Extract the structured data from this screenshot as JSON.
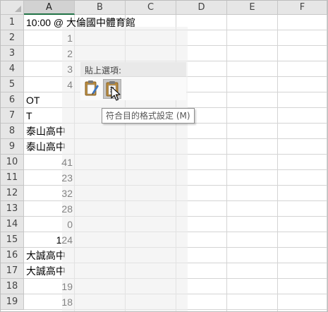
{
  "columns": [
    "A",
    "B",
    "C",
    "D",
    "E",
    "F"
  ],
  "selected_column": "A",
  "rows": [
    {
      "num": "1",
      "a": "10:00 @ 大倫國中體育館",
      "align": "left"
    },
    {
      "num": "2",
      "a": "1",
      "align": "right"
    },
    {
      "num": "3",
      "a": "2",
      "align": "right"
    },
    {
      "num": "4",
      "a": "3",
      "align": "right"
    },
    {
      "num": "5",
      "a": "4",
      "align": "right"
    },
    {
      "num": "6",
      "a": "OT",
      "align": "left"
    },
    {
      "num": "7",
      "a": "T",
      "align": "left"
    },
    {
      "num": "8",
      "a": "泰山高中",
      "align": "left"
    },
    {
      "num": "9",
      "a": "泰山高中",
      "align": "left"
    },
    {
      "num": "10",
      "a": "41",
      "align": "right"
    },
    {
      "num": "11",
      "a": "23",
      "align": "right"
    },
    {
      "num": "12",
      "a": "32",
      "align": "right"
    },
    {
      "num": "13",
      "a": "28",
      "align": "right"
    },
    {
      "num": "14",
      "a": "0",
      "align": "right"
    },
    {
      "num": "15",
      "a": "124",
      "align": "right"
    },
    {
      "num": "16",
      "a": "大誠高中",
      "align": "left"
    },
    {
      "num": "17",
      "a": "大誠高中",
      "align": "left"
    },
    {
      "num": "18",
      "a": "19",
      "align": "right"
    },
    {
      "num": "19",
      "a": "18",
      "align": "right"
    }
  ],
  "paste_options": {
    "label": "貼上選項:",
    "buttons": [
      {
        "icon": "keep-source-formatting-icon"
      },
      {
        "icon": "match-destination-formatting-icon"
      }
    ],
    "tooltip": "符合目的格式設定 (M)"
  },
  "colors": {
    "header_bg": "#e6e6e6",
    "selected_header_bg": "#d2d2d2",
    "accent_green": "#217346",
    "gridline": "#d4d4d4"
  }
}
